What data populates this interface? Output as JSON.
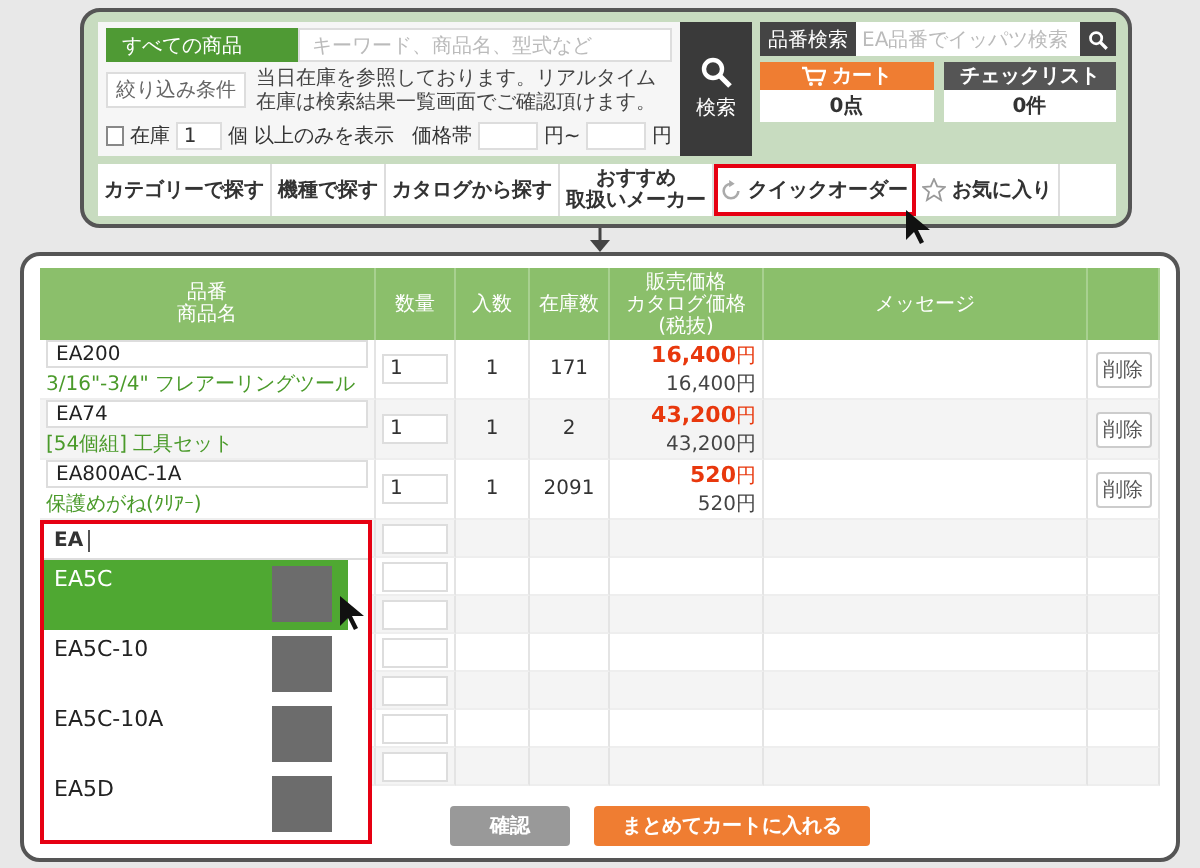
{
  "header": {
    "category_label": "すべての商品",
    "keyword_placeholder": "キーワード、商品名、型式など",
    "filter_tag": "絞り込み条件",
    "notice": "当日在庫を参照しております。リアルタイム在庫は検索結果一覧画面でご確認頂けます。",
    "stock_filter": {
      "checked": false,
      "label": "在庫",
      "value": "1",
      "suffix": "個 以上のみを表示"
    },
    "price_range": {
      "label": "価格帯",
      "from_suffix": "円~",
      "to_suffix": "円"
    },
    "search_button": "検索",
    "part_search": {
      "label": "品番検索",
      "placeholder": "EA品番でイッパツ検索"
    },
    "cart": {
      "label": "カート",
      "value": "0点"
    },
    "checklist": {
      "label": "チェックリスト",
      "value": "0件"
    }
  },
  "nav": {
    "items": [
      {
        "lines": [
          "カテゴリーで探す"
        ],
        "highlighted": false
      },
      {
        "lines": [
          "機種で探す"
        ],
        "highlighted": false
      },
      {
        "lines": [
          "カタログから探す"
        ],
        "highlighted": false
      },
      {
        "lines": [
          "おすすめ",
          "取扱いメーカー"
        ],
        "highlighted": false
      },
      {
        "lines": [
          "クイックオーダー"
        ],
        "highlighted": true,
        "kind": "quick"
      },
      {
        "lines": [
          "お気に入り"
        ],
        "highlighted": false,
        "kind": "favorite"
      }
    ]
  },
  "order": {
    "columns": [
      {
        "lines": [
          "品番",
          "商品名"
        ]
      },
      {
        "lines": [
          "数量"
        ]
      },
      {
        "lines": [
          "入数"
        ]
      },
      {
        "lines": [
          "在庫数"
        ]
      },
      {
        "lines": [
          "販売価格",
          "カタログ価格",
          "(税抜)"
        ]
      },
      {
        "lines": [
          "メッセージ"
        ]
      }
    ],
    "rows": [
      {
        "kind": "item",
        "code": "EA200",
        "name": "3/16\"-3/4\" フレアーリングツール",
        "qty": "1",
        "pack": "1",
        "stock": "171",
        "price": "16,400",
        "price_unit": "円",
        "catalog_price": "16,400円",
        "delete": "削除"
      },
      {
        "kind": "item",
        "code": "EA74",
        "name": "[54個組] 工具セット",
        "qty": "1",
        "pack": "1",
        "stock": "2",
        "price": "43,200",
        "price_unit": "円",
        "catalog_price": "43,200円",
        "delete": "削除"
      },
      {
        "kind": "item",
        "code": "EA800AC-1A",
        "name": "保護めがね(ｸﾘｱｰ)",
        "qty": "1",
        "pack": "1",
        "stock": "2091",
        "price": "520",
        "price_unit": "円",
        "catalog_price": "520円",
        "delete": "削除"
      },
      {
        "kind": "blank"
      },
      {
        "kind": "blank"
      },
      {
        "kind": "blank"
      },
      {
        "kind": "blank"
      },
      {
        "kind": "blank"
      },
      {
        "kind": "blank"
      },
      {
        "kind": "blank"
      }
    ],
    "autocomplete": {
      "query": "EA",
      "highlighted": true,
      "items": [
        {
          "code": "EA5C",
          "selected": true
        },
        {
          "code": "EA5C-10",
          "selected": false
        },
        {
          "code": "EA5C-10A",
          "selected": false
        },
        {
          "code": "EA5D",
          "selected": false
        }
      ]
    },
    "buttons": [
      {
        "label": "確認",
        "kind": "secondary"
      },
      {
        "label": "まとめてカートに入れる",
        "kind": "primary"
      }
    ]
  }
}
